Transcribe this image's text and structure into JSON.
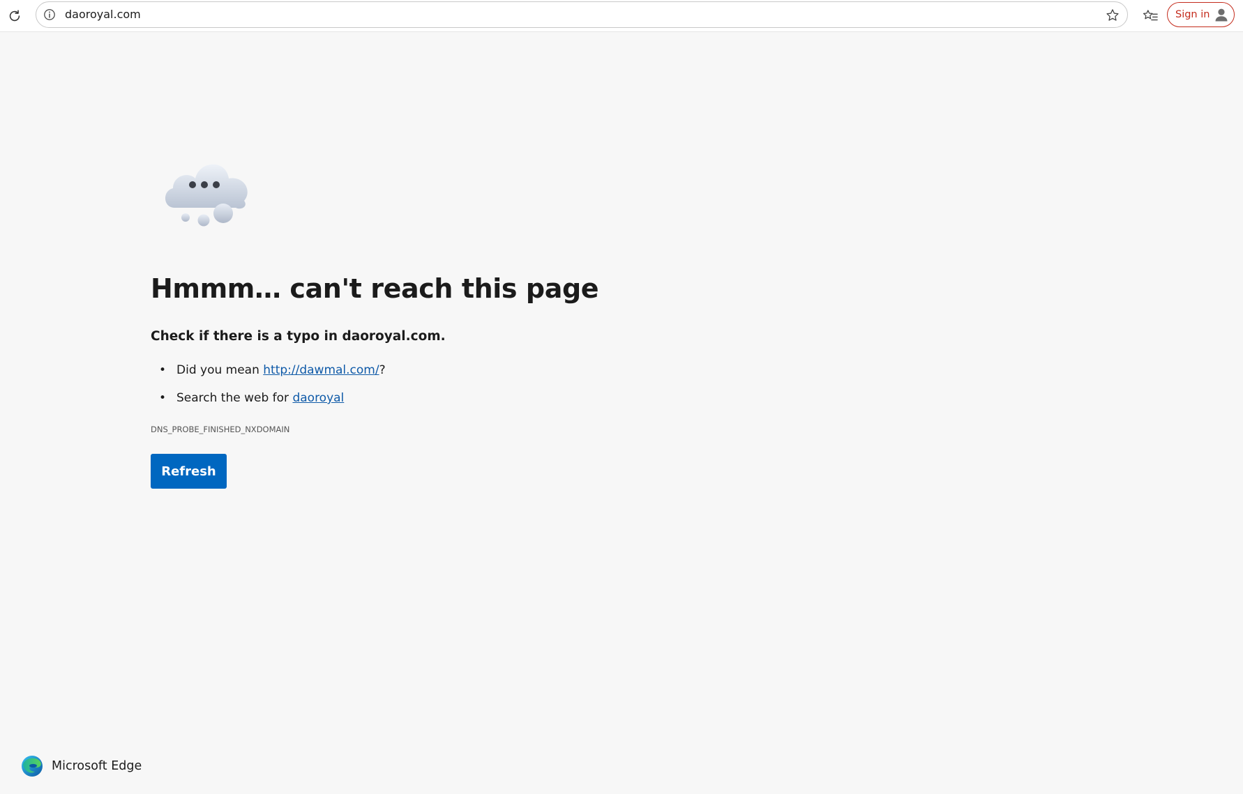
{
  "browser": {
    "address_bar": {
      "url": "daoroyal.com"
    },
    "signin_label": "Sign in",
    "icons": {
      "refresh": "refresh-icon",
      "info": "info-icon",
      "star": "star-icon",
      "favorites": "favorites-icon",
      "avatar": "avatar-icon"
    },
    "accent_color": "#c42b1c"
  },
  "error_page": {
    "title": "Hmmm… can't reach this page",
    "subtitle": "Check if there is a typo in daoroyal.com.",
    "suggestions": [
      {
        "prefix": "Did you mean ",
        "link_text": "http://dawmal.com/",
        "suffix": "?"
      },
      {
        "prefix": "Search the web for ",
        "link_text": "daoroyal",
        "suffix": ""
      }
    ],
    "error_code": "DNS_PROBE_FINISHED_NXDOMAIN",
    "refresh_label": "Refresh",
    "refresh_color": "#0067c0",
    "link_color": "#0f5aa8"
  },
  "footer": {
    "brand": "Microsoft Edge"
  }
}
